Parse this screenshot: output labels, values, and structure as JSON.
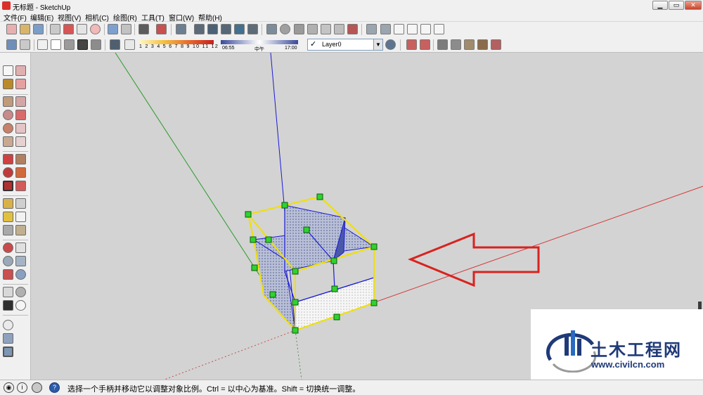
{
  "window": {
    "title": "无标题 - SketchUp"
  },
  "menu": [
    {
      "label": "文件(F)"
    },
    {
      "label": "编辑(E)"
    },
    {
      "label": "视图(V)"
    },
    {
      "label": "相机(C)"
    },
    {
      "label": "绘图(R)"
    },
    {
      "label": "工具(T)"
    },
    {
      "label": "窗口(W)"
    },
    {
      "label": "帮助(H)"
    }
  ],
  "toolbar2": {
    "shadow_palette_scale": "1 2 3 4 5 6 7 8 9 10 11 12",
    "time_start": "06:55",
    "time_mid": "中午",
    "time_end": "17:00",
    "layer": {
      "checked": "✓",
      "name": "Layer0"
    }
  },
  "status": {
    "message": "选择一个手柄并移动它以调整对象比例。Ctrl = 以中心为基准。Shift = 切换统一调整。"
  },
  "watermark": {
    "title": "土木工程网",
    "url": "www.civilcn.com"
  },
  "colors": {
    "axis_green": "#2a9a2a",
    "axis_blue": "#1a1ad6",
    "axis_red": "#d43535",
    "scale_box": "#f0e000",
    "handle": "#2fd22f",
    "arrow": "#d8231f",
    "watermark": "#1f3a78"
  }
}
